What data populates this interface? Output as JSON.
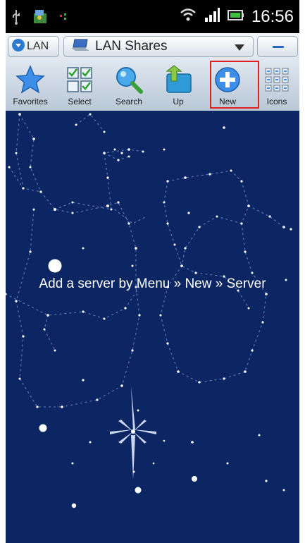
{
  "status_bar": {
    "time": "16:56",
    "icons": [
      "usb-icon",
      "app-notification-icon",
      "signal-dots-icon",
      "wifi-icon",
      "cell-signal-icon",
      "battery-icon"
    ]
  },
  "top_bar": {
    "lan_button_label": "LAN",
    "dropdown_label": "LAN Shares",
    "icons": [
      "lan-shield-icon",
      "laptop-icon",
      "chevron-down-icon",
      "minus-icon"
    ]
  },
  "toolbar": {
    "items": [
      {
        "label": "Favorites",
        "icon": "star-icon"
      },
      {
        "label": "Select",
        "icon": "checkbox-grid-icon"
      },
      {
        "label": "Search",
        "icon": "magnifier-icon"
      },
      {
        "label": "Up",
        "icon": "folder-up-icon"
      },
      {
        "label": "New",
        "icon": "plus-circle-icon"
      },
      {
        "label": "Icons",
        "icon": "grid-view-icon"
      }
    ]
  },
  "colors": {
    "sky_background": "#0c2663",
    "highlight_border": "#e02020",
    "accent_blue": "#2a6ac4"
  },
  "main": {
    "empty_message": "Add a server by Menu » New » Server"
  }
}
